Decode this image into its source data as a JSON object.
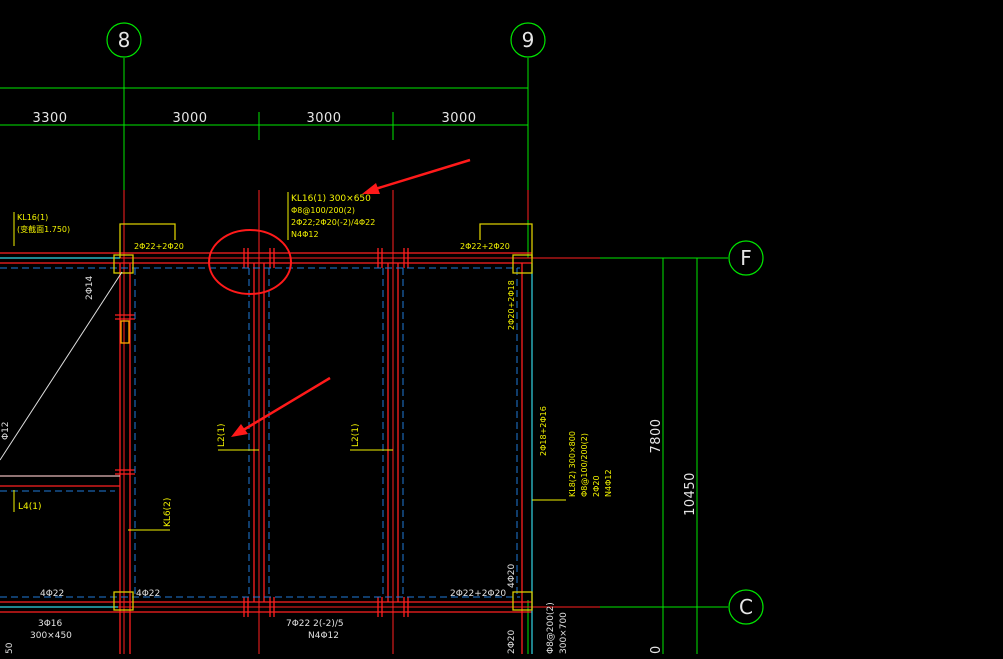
{
  "axes": {
    "grid_8": "8",
    "grid_9": "9",
    "grid_F": "F",
    "grid_C": "C"
  },
  "dimensions": {
    "top": [
      "3300",
      "3000",
      "3000",
      "3000"
    ],
    "right_inner": "7800",
    "right_outer": "10450"
  },
  "beam_labels": {
    "kl16_1": [
      "KL16(1) 300×650",
      "Φ8@100/200(2)",
      "2Φ22;2Φ20(-2)/4Φ22",
      "N4Φ12"
    ],
    "kl16_left": [
      "KL16(1)",
      "(变截面1.750)"
    ],
    "top_left_bar": "2Φ22+2Φ20",
    "top_right_bar": "2Φ22+2Φ20",
    "right_vert_top": "2Φ20+2Φ18",
    "right_vert_mid": "2Φ18+2Φ16",
    "kl8": [
      "KL8(2) 300×800",
      "Φ8@100/200(2)",
      "2Φ20",
      "N4Φ12"
    ],
    "l2_a": "L2(1)",
    "l2_b": "L2(1)",
    "l6": "KL6(2)",
    "l4": "L4(1)",
    "diag": "2Φ14",
    "left_vert": "Φ12",
    "bot_left_1": "4Φ22",
    "bot_left_2": "4Φ22",
    "bot_mid": [
      "7Φ22 2(-2)/5",
      "N4Φ12"
    ],
    "bot_right": "2Φ22+2Φ20",
    "bot_right_vert": "4Φ20",
    "bot_left_beam": [
      "3Φ16",
      "300×450"
    ],
    "bot_far_left": "50",
    "bot_r1": "2Φ20",
    "bot_r2": "Φ8@200(2)",
    "bot_r3": "300×700",
    "bot_dim": "0"
  },
  "colors": {
    "background": "#000000",
    "grid_green": "#00e600",
    "beam_red": "#ff2020",
    "dash_blue": "#1f7ad8",
    "cyan": "#33d6e6",
    "annotation_yellow": "#f2f200",
    "column_yellow": "#d9cc00",
    "highlight_red": "#ff1a1a"
  }
}
